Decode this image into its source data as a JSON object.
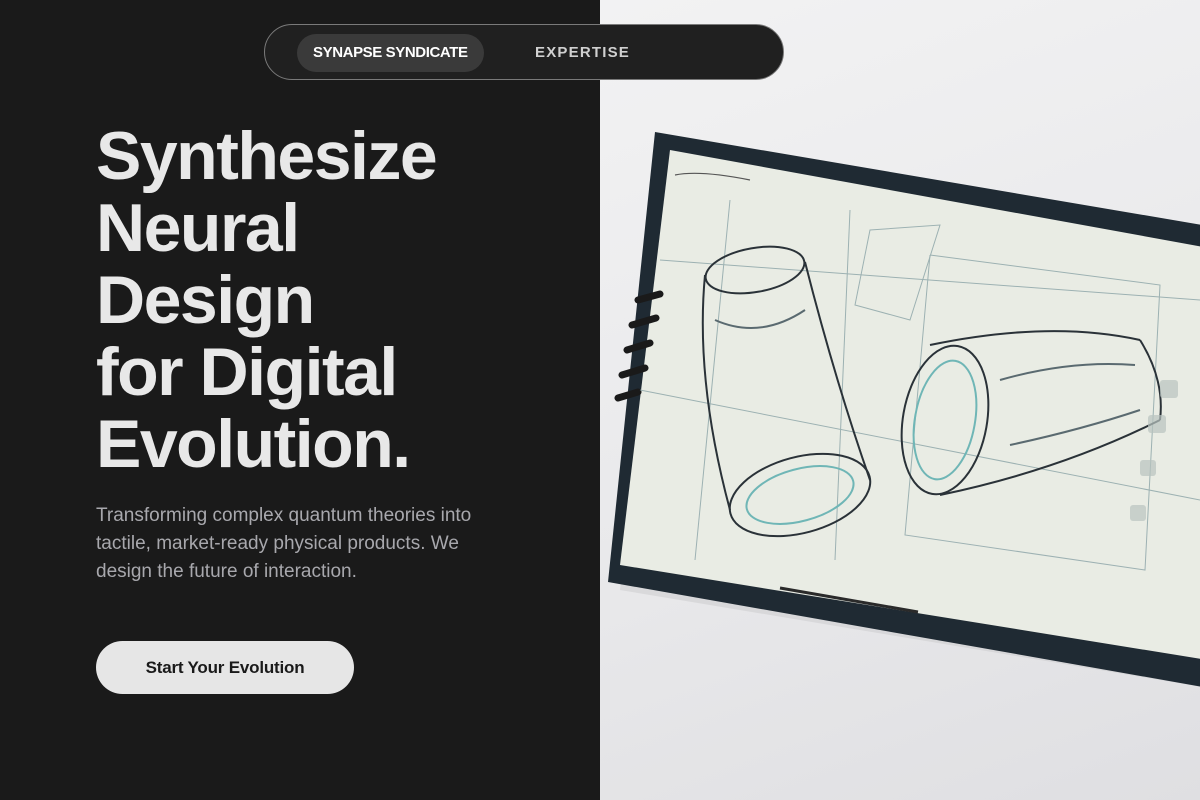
{
  "nav": {
    "brand": "SYNAPSE SYNDICATE",
    "link_1": "EXPERTISE"
  },
  "hero": {
    "headline_lines": [
      "Synthesize",
      "Neural",
      "Design",
      "for Digital",
      "Evolution."
    ],
    "subtext": "Transforming complex quantum theories into tactile, market-ready physical products. We design the future of interaction.",
    "cta_label": "Start Your Evolution"
  },
  "image": {
    "subject": "tablet-with-product-sketch"
  },
  "colors": {
    "background": "#1a1a1a",
    "headline": "#e8e8e8",
    "subtext": "#a8a8ad",
    "cta_bg": "#e6e6e6",
    "brand_pill": "#3a3a3a"
  }
}
